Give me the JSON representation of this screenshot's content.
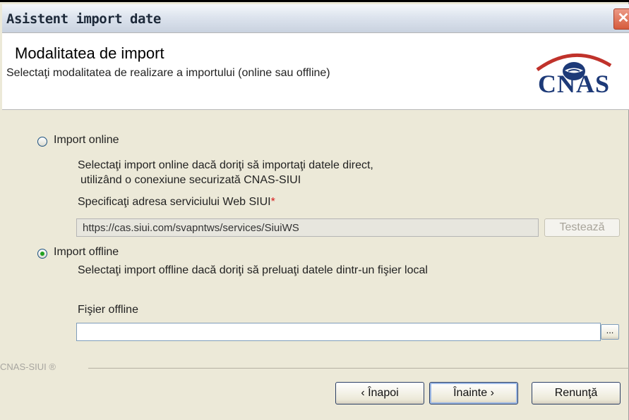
{
  "window": {
    "title": "Asistent import date",
    "close_symbol": "✕"
  },
  "header": {
    "title": "Modalitatea de import",
    "subtitle": "Selectaţi modalitatea de realizare a importului (online sau offline)",
    "logo_text": "CNAS"
  },
  "online": {
    "label": "Import online",
    "selected": false,
    "desc_line1": "Selectaţi import online dacă doriţi să importaţi datele direct,",
    "desc_line2": "utilizând o conexiune securizată CNAS-SIUI",
    "address_label": "Specificaţi adresa serviciului Web SIUI",
    "required_mark": "*",
    "address_value": "https://cas.siui.com/svapntws/services/SiuiWS",
    "test_button": "Testează"
  },
  "offline": {
    "label": "Import offline",
    "selected": true,
    "desc": "Selectaţi import offline dacă doriţi să preluaţi datele dintr-un fişier local",
    "file_label": "Fişier offline",
    "file_value": "",
    "browse_button": "..."
  },
  "footer": {
    "brand": "CNAS-SIUI ®",
    "back_button": "‹ Înapoi",
    "next_button": "Înainte ›",
    "cancel_button": "Renunţă"
  },
  "colors": {
    "logo_blue": "#1d3a78",
    "logo_red": "#c0322b",
    "accent_radio": "#21a121"
  }
}
